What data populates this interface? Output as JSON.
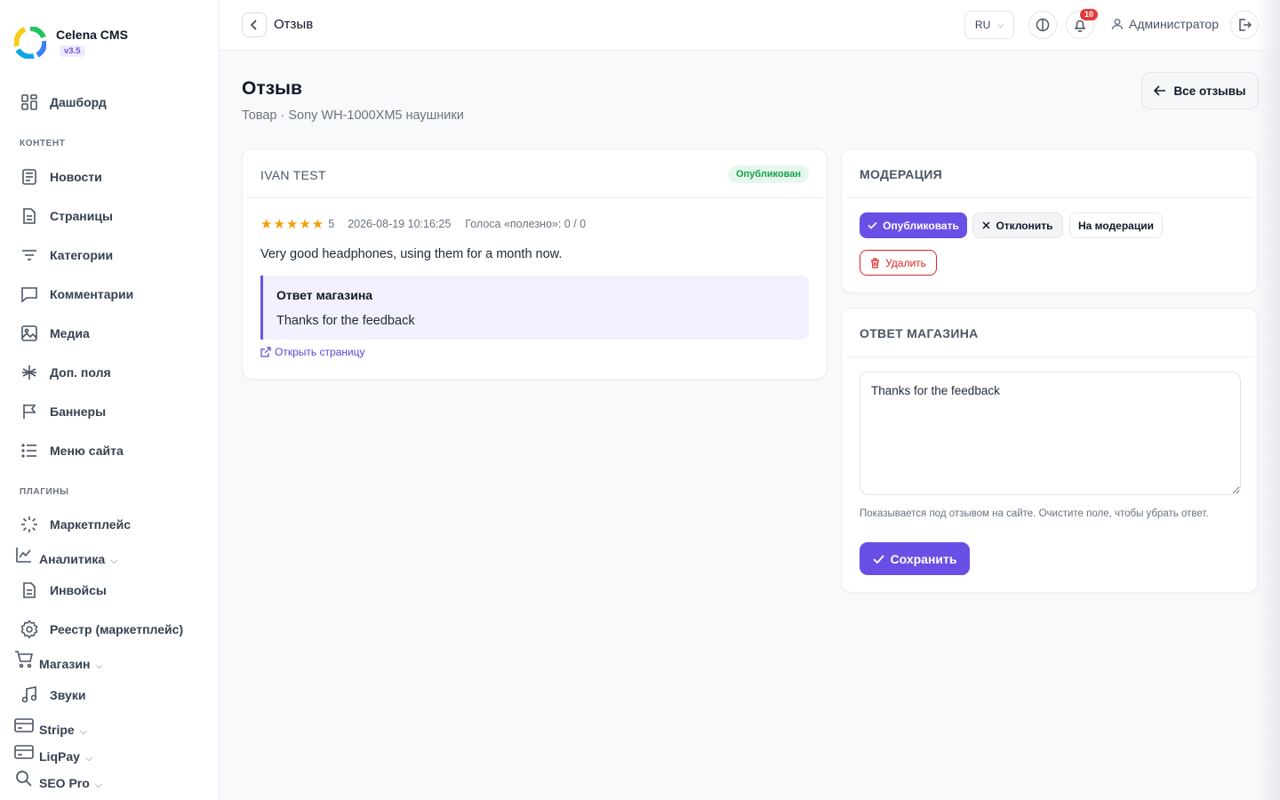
{
  "brand": {
    "name": "Celena CMS",
    "version": "v3.5"
  },
  "sidebar": {
    "sections": {
      "content": "КОНТЕНТ",
      "plugins": "ПЛАГИНЫ"
    },
    "items": [
      {
        "label": "Дашборд",
        "icon": "dashboard-icon"
      },
      {
        "label": "Новости",
        "icon": "news-icon"
      },
      {
        "label": "Страницы",
        "icon": "page-icon"
      },
      {
        "label": "Категории",
        "icon": "category-icon"
      },
      {
        "label": "Комментарии",
        "icon": "comment-icon"
      },
      {
        "label": "Медиа",
        "icon": "image-icon"
      },
      {
        "label": "Доп. поля",
        "icon": "asterisk-icon"
      },
      {
        "label": "Баннеры",
        "icon": "flag-icon"
      },
      {
        "label": "Меню сайта",
        "icon": "list-icon"
      },
      {
        "label": "Маркетплейс",
        "icon": "loader-icon"
      },
      {
        "label": "Аналитика",
        "icon": "chart-icon"
      },
      {
        "label": "Инвойсы",
        "icon": "invoice-icon"
      },
      {
        "label": "Реестр (маркетплейс)",
        "icon": "gear-icon"
      },
      {
        "label": "Магазин",
        "icon": "cart-icon"
      },
      {
        "label": "Звуки",
        "icon": "music-icon"
      },
      {
        "label": "Stripe",
        "icon": "card-icon"
      },
      {
        "label": "LiqPay",
        "icon": "card-icon"
      },
      {
        "label": "SEO Pro",
        "icon": "search-icon"
      }
    ]
  },
  "header": {
    "title": "Отзыв",
    "language": "RU",
    "notifications_count": "10",
    "user": "Администратор"
  },
  "page": {
    "title": "Отзыв",
    "subtitle": "Товар · Sony WH-1000XM5 наушники",
    "all_reviews_label": "Все отзывы"
  },
  "review": {
    "author": "IVAN TEST",
    "status": "Опубликован",
    "stars": "★★★★★",
    "rating": "5",
    "date": "2026-08-19 10:16:25",
    "votes": "Голоса «полезно»: 0 / 0",
    "text": "Very good headphones, using them for a month now.",
    "reply_title": "Ответ магазина",
    "reply_text": "Thanks for the feedback",
    "open_page_label": "Открыть страницу"
  },
  "moderation": {
    "title": "МОДЕРАЦИЯ",
    "publish_label": "Опубликовать",
    "reject_label": "Отклонить",
    "pending_label": "На модерации",
    "delete_label": "Удалить"
  },
  "reply_form": {
    "title": "ОТВЕТ МАГАЗИНА",
    "value": "Thanks for the feedback",
    "hint": "Показывается под отзывом на сайте. Очистите поле, чтобы убрать ответ.",
    "save_label": "Сохранить"
  },
  "colors": {
    "accent": "#6a4fe6",
    "success": "#16a34a",
    "danger": "#dc2626",
    "star": "#f59e0b",
    "badge": "#e23b3b"
  }
}
